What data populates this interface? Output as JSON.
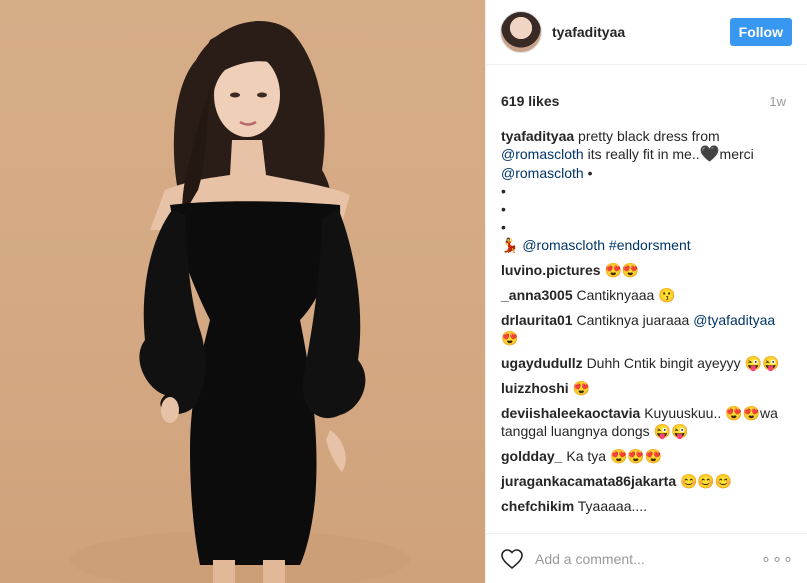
{
  "post": {
    "username": "tyafadityaa",
    "follow_label": "Follow",
    "likes": "619 likes",
    "time": "1w",
    "caption_username": "tyafadityaa",
    "caption_text_1": "pretty black dress from",
    "caption_mention_1": "@romascloth",
    "caption_text_2": "its really fit in me..",
    "caption_heart": "🖤",
    "caption_text_3": "merci",
    "caption_mention_2": "@romascloth",
    "caption_bullet": "•",
    "dots": [
      "•",
      "•",
      "•"
    ],
    "tag_mention": "@romascloth",
    "tag_hashtag": "#endorsment",
    "comments": [
      {
        "user": "luvino.pictures",
        "text": "😍😍"
      },
      {
        "user": "_anna3005",
        "text": "Cantiknyaaa 😗"
      },
      {
        "user": "drlaurita01",
        "text": "Cantiknya juaraaa",
        "mention": "@tyafadityaa",
        "after": "😍"
      },
      {
        "user": "ugaydudullz",
        "text": "Duhh Cntik bingit ayeyyy 😜😜"
      },
      {
        "user": "luizzhoshi",
        "text": "😍"
      },
      {
        "user": "deviishaleekaoctavia",
        "text": "Kuyuuskuu.. 😍😍wa tanggal luangnya dongs 😜😜"
      },
      {
        "user": "goldday_",
        "text": "Ka tya 😍😍😍"
      },
      {
        "user": "juragankacamata86jakarta",
        "text": "😊😊😊"
      },
      {
        "user": "chefchikim",
        "text": "Tyaaaaa...."
      }
    ],
    "add_comment_placeholder": "Add a comment...",
    "more_label": "∘∘∘"
  }
}
